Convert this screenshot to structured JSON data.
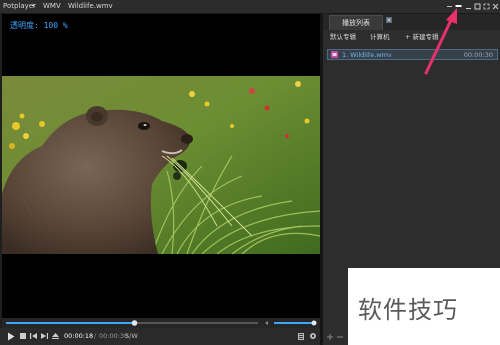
{
  "titlebar": {
    "app_name": "Potplayer",
    "format": "WMV",
    "file": "Wildlife.wmv"
  },
  "osd": {
    "text": "透明度: 100 %"
  },
  "controls": {
    "current_time": "00:00:18",
    "separator": "/",
    "total_time": "00:00:30",
    "mode": "S/W",
    "seek_progress_percent": 51,
    "volume_percent": 100
  },
  "playlist": {
    "tab_label": "播放列表",
    "buttons": [
      "默认专辑",
      "计算机",
      "+ 新建专辑"
    ],
    "items": [
      {
        "title": "1. Wildlife.wmv",
        "duration": "00:00:30"
      }
    ]
  },
  "watermark": {
    "text": "软件技巧"
  },
  "colors": {
    "accent": "#3fa6ff",
    "annotation_arrow": "#e8306d"
  }
}
